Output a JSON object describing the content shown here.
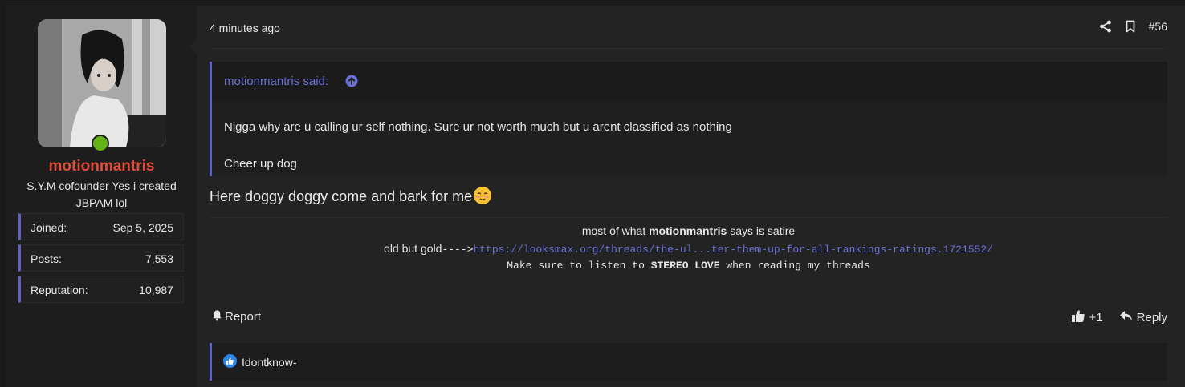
{
  "user": {
    "name": "motionmantris",
    "title": "S.Y.M cofounder Yes i created JBPAM lol",
    "stats": [
      {
        "label": "Joined:",
        "value": "Sep 5, 2025"
      },
      {
        "label": "Posts:",
        "value": "7,553"
      },
      {
        "label": "Reputation:",
        "value": "10,987"
      }
    ]
  },
  "post": {
    "time": "4 minutes ago",
    "number": "#56",
    "quote": {
      "author_said": "motionmantris said:",
      "lines": [
        "Nigga why are u calling ur self nothing. Sure ur not worth much but u arent classified as nothing",
        "Cheer up dog"
      ]
    },
    "body": "Here doggy doggy come and bark for me",
    "signature": {
      "line1_pre": "most of what ",
      "line1_bold": "motionmantris",
      "line1_post": " says is satire",
      "line2_pre": "old but gold",
      "line2_arrow": "---->",
      "line2_link": "https://looksmax.org/threads/the-ul...ter-them-up-for-all-rankings-ratings.1721552/",
      "line3_pre": "Make sure to listen to ",
      "line3_bold": "STEREO LOVE",
      "line3_post": " when reading my threads"
    },
    "actions": {
      "report": "Report",
      "like_count": "+1",
      "reply": "Reply"
    },
    "reactions": {
      "users": "Idontknow-"
    }
  },
  "colors": {
    "accent": "#5c62c6",
    "link": "#6a70d6",
    "username": "#e24b3a",
    "online": "#64b218"
  }
}
